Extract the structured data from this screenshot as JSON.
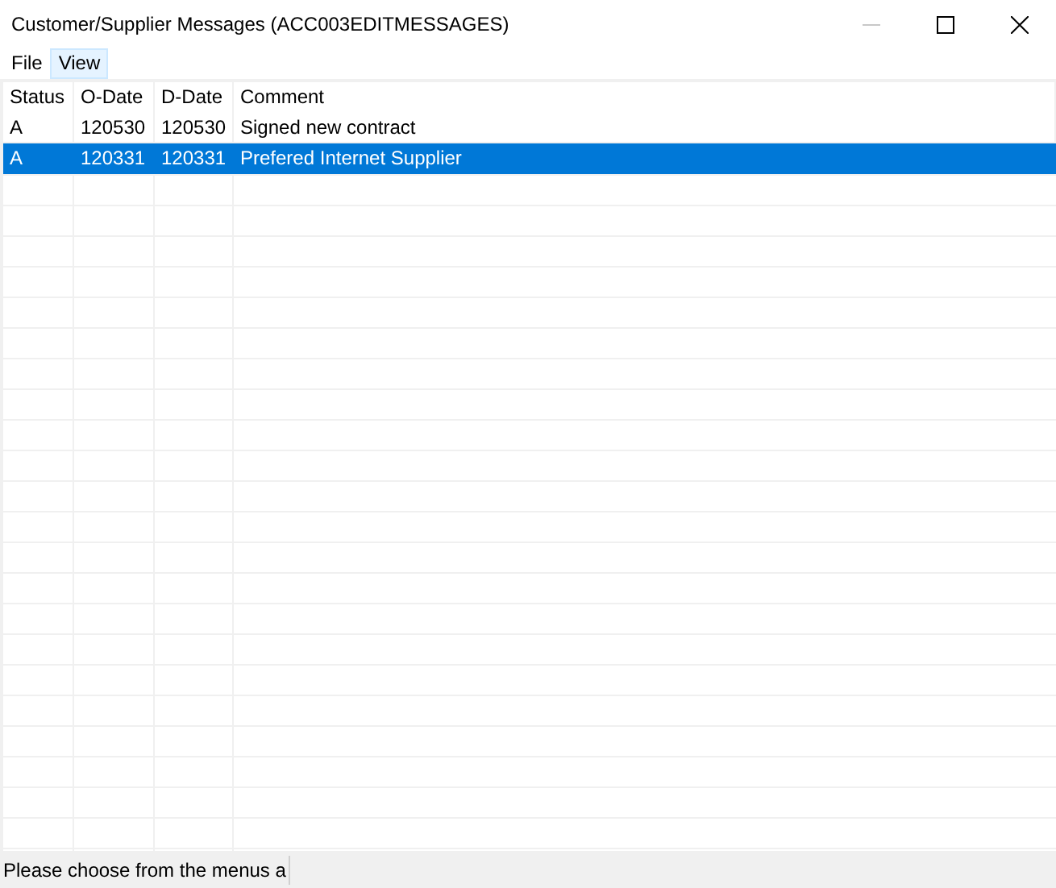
{
  "window": {
    "title": "Customer/Supplier Messages (ACC003EDITMESSAGES)",
    "minimize_disabled": true
  },
  "menu": [
    {
      "label": "File",
      "highlighted": false
    },
    {
      "label": "View",
      "highlighted": true
    }
  ],
  "table": {
    "columns": [
      "Status",
      "O-Date",
      "D-Date",
      "Comment"
    ],
    "rows": [
      {
        "cells": [
          "A",
          "120530",
          "120530",
          "Signed new contract"
        ],
        "selected": false
      },
      {
        "cells": [
          "A",
          "120331",
          "120331",
          "Prefered Internet Supplier"
        ],
        "selected": true
      }
    ]
  },
  "status_bar": "Please choose from the menus a"
}
